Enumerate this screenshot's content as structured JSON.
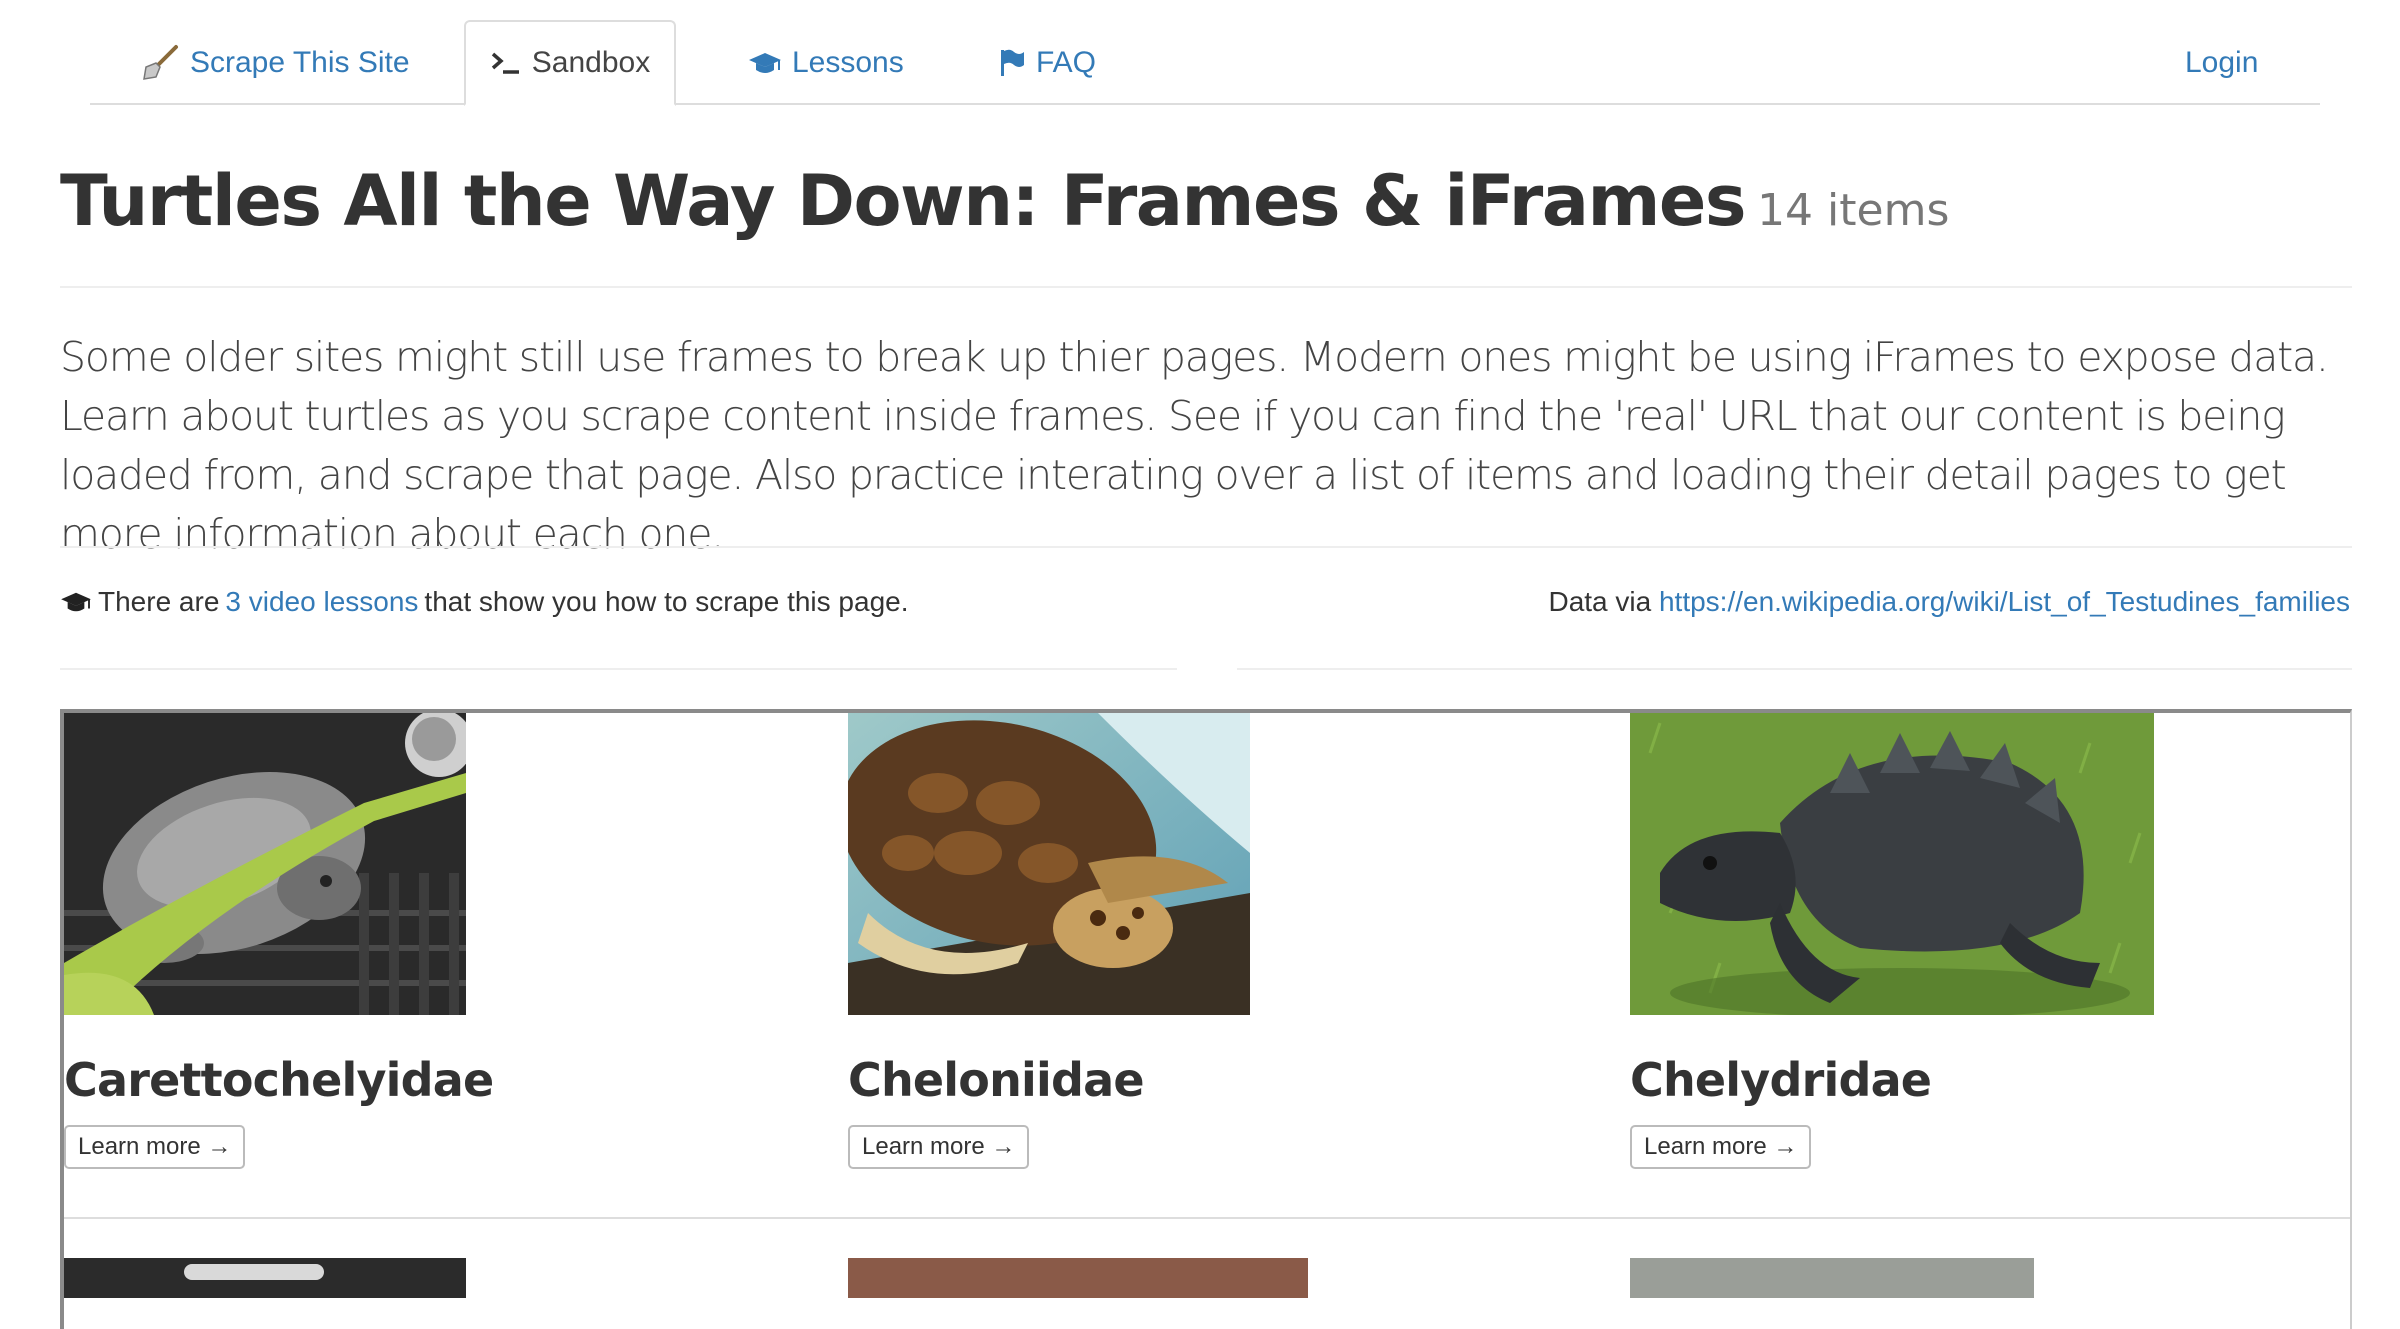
{
  "nav": {
    "brand": "Scrape This Site",
    "sandbox": "Sandbox",
    "lessons": "Lessons",
    "faq": "FAQ",
    "login": "Login"
  },
  "header": {
    "title": "Turtles All the Way Down: Frames & iFrames",
    "count": "14 items"
  },
  "lead": "Some older sites might still use frames to break up thier pages. Modern ones might be using iFrames to expose data. Learn about turtles as you scrape content inside frames. See if you can find the 'real' URL that our content is being loaded from, and scrape that page. Also practice interating over a list of items and loading their detail pages to get more information about each one.",
  "lessons_line": {
    "prefix": "There are",
    "link": "3 video lessons",
    "suffix": "that show you how to scrape this page."
  },
  "data_via": {
    "label": "Data via",
    "link": "https://en.wikipedia.org/wiki/List_of_Testudines_families"
  },
  "turtles": [
    {
      "name": "Carettochelyidae",
      "button": "Learn more →"
    },
    {
      "name": "Cheloniidae",
      "button": "Learn more →"
    },
    {
      "name": "Chelydridae",
      "button": "Learn more →"
    }
  ],
  "colors": {
    "link": "#337ab7",
    "text": "#333333",
    "muted": "#777777"
  }
}
